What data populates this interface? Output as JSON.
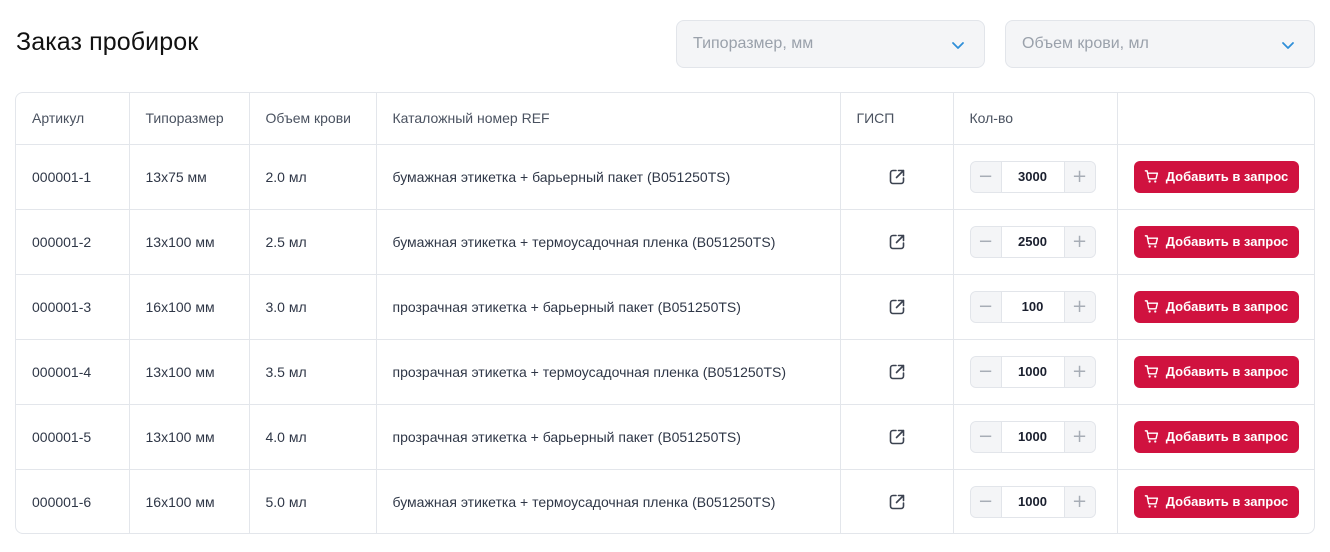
{
  "page": {
    "title": "Заказ пробирок"
  },
  "filters": {
    "size": {
      "placeholder": "Типоразмер, мм",
      "icon": "chevron-down-icon"
    },
    "volume": {
      "placeholder": "Объем крови, мл",
      "icon": "chevron-down-icon"
    }
  },
  "table": {
    "headers": [
      "Артикул",
      "Типоразмер",
      "Объем крови",
      "Каталожный номер REF",
      "ГИСП",
      "Кол-во",
      ""
    ],
    "rows": [
      {
        "article": "000001-1",
        "size": "13х75 мм",
        "volume": "2.0 мл",
        "ref": "бумажная этикетка + барьерный пакет (B051250TS)",
        "qty": "3000",
        "button": "Добавить в запрос"
      },
      {
        "article": "000001-2",
        "size": "13х100 мм",
        "volume": "2.5 мл",
        "ref": "бумажная этикетка + термоусадочная пленка (B051250TS)",
        "qty": "2500",
        "button": "Добавить в запрос"
      },
      {
        "article": "000001-3",
        "size": "16х100 мм",
        "volume": "3.0 мл",
        "ref": "прозрачная этикетка + барьерный пакет (B051250TS)",
        "qty": "100",
        "button": "Добавить в запрос"
      },
      {
        "article": "000001-4",
        "size": "13х100 мм",
        "volume": "3.5 мл",
        "ref": "прозрачная этикетка + термоусадочная пленка (B051250TS)",
        "qty": "1000",
        "button": "Добавить в запрос"
      },
      {
        "article": "000001-5",
        "size": "13х100 мм",
        "volume": "4.0 мл",
        "ref": "прозрачная этикетка + барьерный пакет (B051250TS)",
        "qty": "1000",
        "button": "Добавить в запрос"
      },
      {
        "article": "000001-6",
        "size": "16х100 мм",
        "volume": "5.0 мл",
        "ref": "бумажная этикетка + термоусадочная пленка (B051250TS)",
        "qty": "1000",
        "button": "Добавить в запрос"
      }
    ]
  },
  "stepper": {
    "minus": "−",
    "plus": "+"
  },
  "icons": {
    "gisp": "external-link-icon",
    "cart": "cart-icon"
  },
  "colors": {
    "accent": "#d0123f",
    "chevron": "#2f8fd8",
    "border": "#e3e6eb",
    "field_bg": "#f4f5f7"
  }
}
